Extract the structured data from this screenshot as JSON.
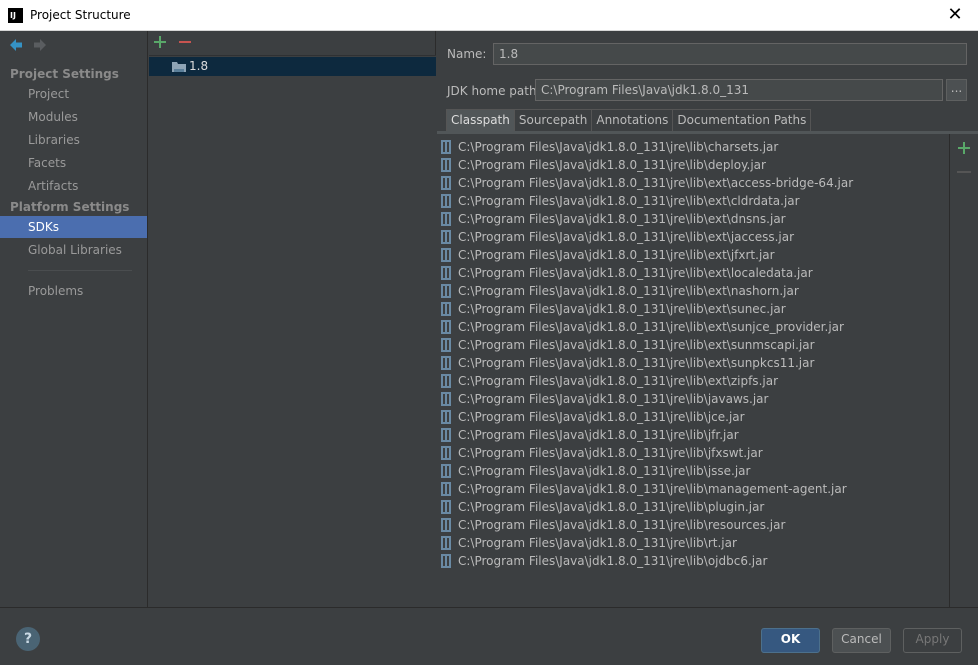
{
  "window": {
    "title": "Project Structure",
    "close_label": "✕"
  },
  "sidebar": {
    "project_settings_header": "Project Settings",
    "project_items": [
      {
        "label": "Project"
      },
      {
        "label": "Modules"
      },
      {
        "label": "Libraries"
      },
      {
        "label": "Facets"
      },
      {
        "label": "Artifacts"
      }
    ],
    "platform_settings_header": "Platform Settings",
    "platform_items": [
      {
        "label": "SDKs",
        "selected": true
      },
      {
        "label": "Global Libraries"
      }
    ],
    "problems_label": "Problems"
  },
  "sdk_list": {
    "items": [
      {
        "label": "1.8",
        "selected": true
      }
    ]
  },
  "details": {
    "name_label": "Name:",
    "name_value": "1.8",
    "jdk_home_label": "JDK home path:",
    "jdk_home_value": "C:\\Program Files\\Java\\jdk1.8.0_131",
    "browse_label": "...",
    "tabs": [
      {
        "label": "Classpath",
        "active": true
      },
      {
        "label": "Sourcepath"
      },
      {
        "label": "Annotations"
      },
      {
        "label": "Documentation Paths"
      }
    ],
    "classpath": [
      "C:\\Program Files\\Java\\jdk1.8.0_131\\jre\\lib\\charsets.jar",
      "C:\\Program Files\\Java\\jdk1.8.0_131\\jre\\lib\\deploy.jar",
      "C:\\Program Files\\Java\\jdk1.8.0_131\\jre\\lib\\ext\\access-bridge-64.jar",
      "C:\\Program Files\\Java\\jdk1.8.0_131\\jre\\lib\\ext\\cldrdata.jar",
      "C:\\Program Files\\Java\\jdk1.8.0_131\\jre\\lib\\ext\\dnsns.jar",
      "C:\\Program Files\\Java\\jdk1.8.0_131\\jre\\lib\\ext\\jaccess.jar",
      "C:\\Program Files\\Java\\jdk1.8.0_131\\jre\\lib\\ext\\jfxrt.jar",
      "C:\\Program Files\\Java\\jdk1.8.0_131\\jre\\lib\\ext\\localedata.jar",
      "C:\\Program Files\\Java\\jdk1.8.0_131\\jre\\lib\\ext\\nashorn.jar",
      "C:\\Program Files\\Java\\jdk1.8.0_131\\jre\\lib\\ext\\sunec.jar",
      "C:\\Program Files\\Java\\jdk1.8.0_131\\jre\\lib\\ext\\sunjce_provider.jar",
      "C:\\Program Files\\Java\\jdk1.8.0_131\\jre\\lib\\ext\\sunmscapi.jar",
      "C:\\Program Files\\Java\\jdk1.8.0_131\\jre\\lib\\ext\\sunpkcs11.jar",
      "C:\\Program Files\\Java\\jdk1.8.0_131\\jre\\lib\\ext\\zipfs.jar",
      "C:\\Program Files\\Java\\jdk1.8.0_131\\jre\\lib\\javaws.jar",
      "C:\\Program Files\\Java\\jdk1.8.0_131\\jre\\lib\\jce.jar",
      "C:\\Program Files\\Java\\jdk1.8.0_131\\jre\\lib\\jfr.jar",
      "C:\\Program Files\\Java\\jdk1.8.0_131\\jre\\lib\\jfxswt.jar",
      "C:\\Program Files\\Java\\jdk1.8.0_131\\jre\\lib\\jsse.jar",
      "C:\\Program Files\\Java\\jdk1.8.0_131\\jre\\lib\\management-agent.jar",
      "C:\\Program Files\\Java\\jdk1.8.0_131\\jre\\lib\\plugin.jar",
      "C:\\Program Files\\Java\\jdk1.8.0_131\\jre\\lib\\resources.jar",
      "C:\\Program Files\\Java\\jdk1.8.0_131\\jre\\lib\\rt.jar",
      "C:\\Program Files\\Java\\jdk1.8.0_131\\jre\\lib\\ojdbc6.jar"
    ]
  },
  "buttons": {
    "help": "?",
    "ok": "OK",
    "cancel": "Cancel",
    "apply": "Apply"
  },
  "colors": {
    "selection": "#4b6eaf",
    "tree_selection": "#0d293e",
    "ok_button": "#365880",
    "add_icon": "#59a869",
    "remove_icon": "#c75450",
    "nav_back": "#3592c4"
  }
}
